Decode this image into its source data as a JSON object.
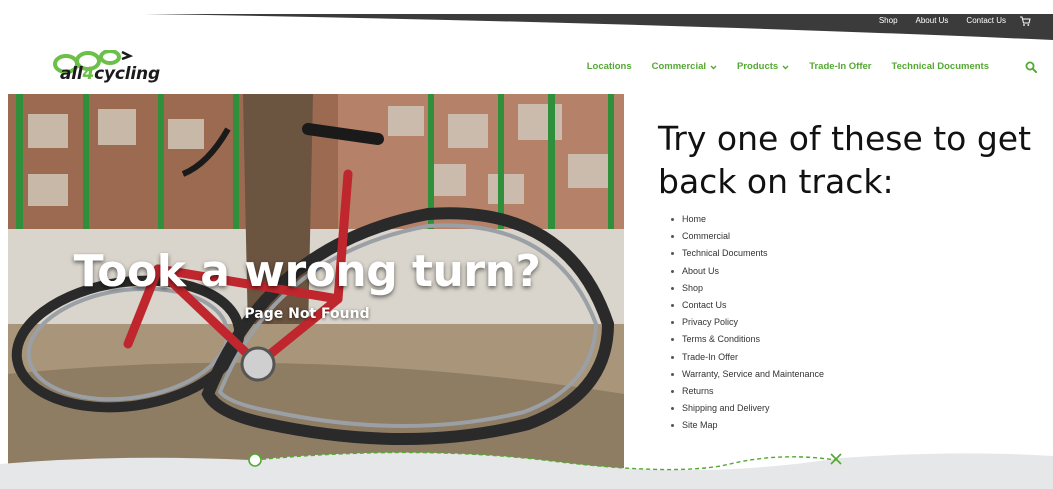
{
  "colors": {
    "brand_green": "#54a932",
    "topbar_dark": "#3b3b3b",
    "footer_gray": "#e6e7e8"
  },
  "topbar": {
    "links": [
      "Shop",
      "About Us",
      "Contact Us"
    ],
    "cart_icon": "cart-icon"
  },
  "logo": {
    "word_prefix": "all",
    "word_num": "4",
    "word_suffix": "cycling"
  },
  "nav": {
    "items": [
      {
        "label": "Locations",
        "dropdown": false
      },
      {
        "label": "Commercial",
        "dropdown": true
      },
      {
        "label": "Products",
        "dropdown": true
      },
      {
        "label": "Trade-In Offer",
        "dropdown": false
      },
      {
        "label": "Technical Documents",
        "dropdown": false
      }
    ],
    "search_icon": "search-icon"
  },
  "hero": {
    "title": "Took a wrong turn?",
    "subtitle": "Page Not Found"
  },
  "suggestions": {
    "heading": "Try one of these to get back on track:",
    "links": [
      "Home",
      "Commercial",
      "Technical Documents",
      "About Us",
      "Shop",
      "Contact Us",
      "Privacy Policy",
      "Terms & Conditions",
      "Trade-In Offer",
      "Warranty, Service and Maintenance",
      "Returns",
      "Shipping and Delivery",
      "Site Map"
    ]
  }
}
